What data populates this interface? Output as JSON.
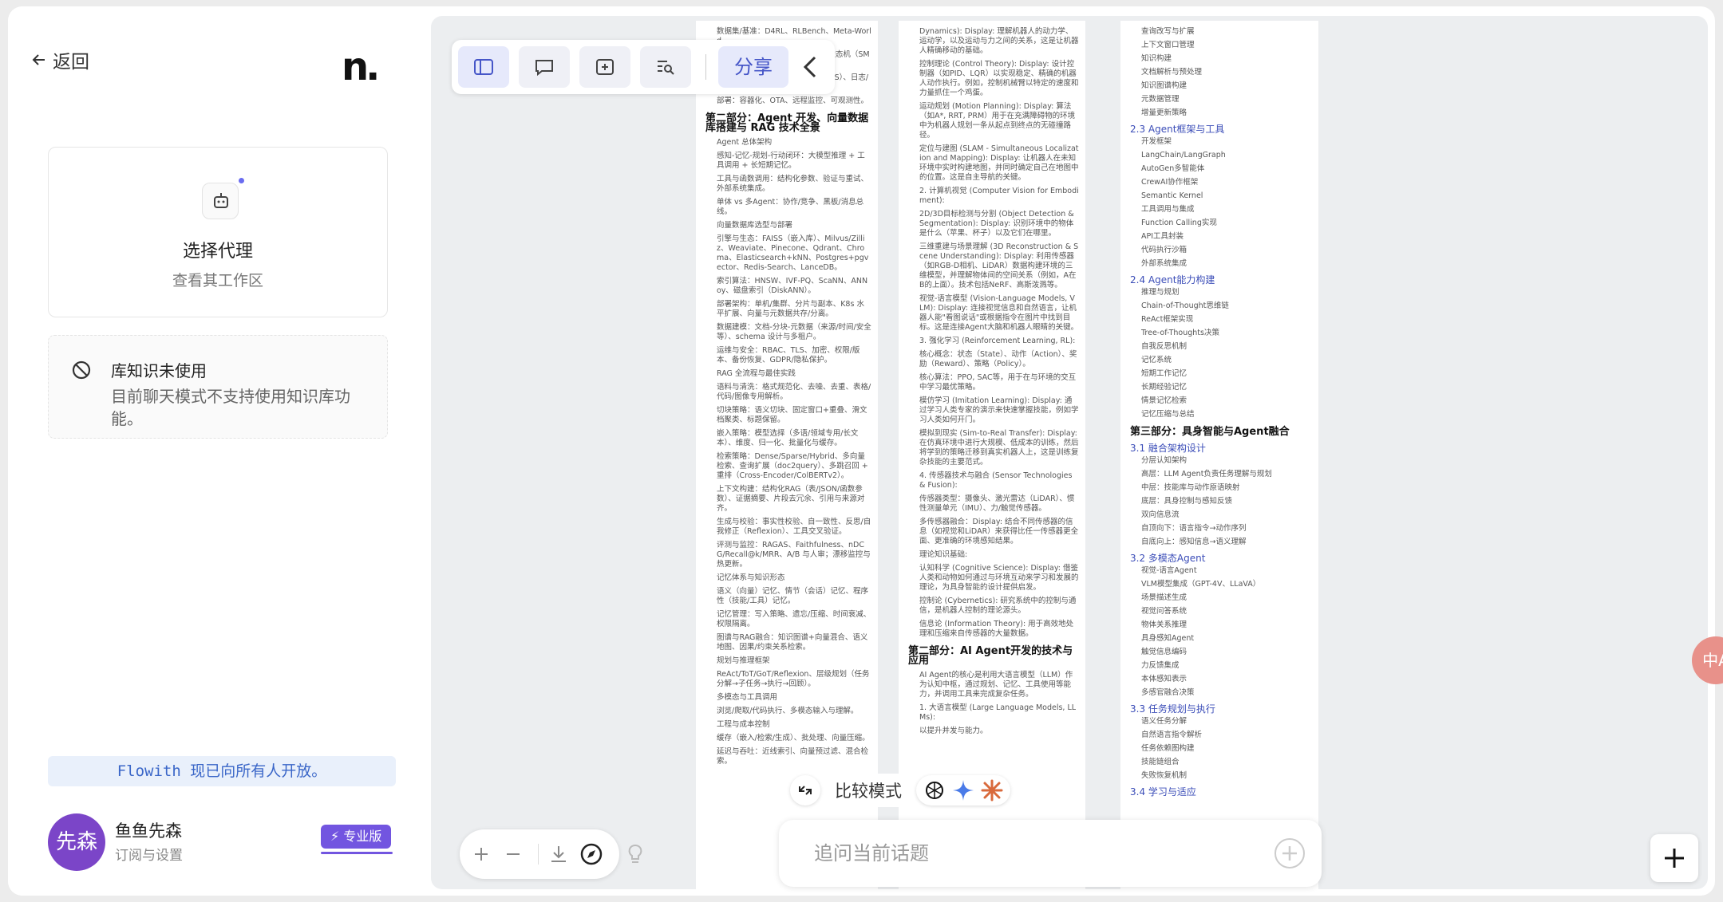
{
  "sidebar": {
    "back_label": "返回",
    "logo": "n.",
    "agent_card": {
      "title": "选择代理",
      "subtitle": "查看其工作区"
    },
    "kb_card": {
      "title": "库知识未使用",
      "subtitle": "目前聊天模式不支持使用知识库功能。"
    },
    "banner": "Flowith 现已向所有人开放。",
    "user": {
      "avatar_text": "先森",
      "name": "鱼鱼先森",
      "subtitle": "订阅与设置",
      "badge": "专业版"
    }
  },
  "toolbar": {
    "share_label": "分享"
  },
  "compare": {
    "label": "比较模式"
  },
  "chat": {
    "placeholder": "追问当前话题"
  },
  "translate_badge": "中A",
  "doc": {
    "p1": [
      "数据集/基准：D4RL、RLBench、Meta-World",
      "ROS2/RT-Middleware、行为树/状态机（SMACH/BehaviorTree.CPP）。",
      "软件架构：节点化、实时通信（DDS）、日志/回放（rosbag）。",
      "部署：容器化、OTA、远程监控、可观测性。",
      "第二部分：Agent 开发、向量数据库搭建与 RAG 技术全景",
      "Agent 总体架构",
      "感知-记忆-规划-行动闭环：大模型推理 + 工具调用 + 长短期记忆。",
      "工具与函数调用：结构化参数、验证与重试、外部系统集成。",
      "单体 vs 多Agent：协作/竞争、黑板/消息总线。",
      "向量数据库选型与部署",
      "引擎与生态：FAISS（嵌入库）、Milvus/Zilliz、Weaviate、Pinecone、Qdrant、Chroma、Elasticsearch+kNN、Postgres+pgvector、Redis-Search、LanceDB。",
      "索引算法：HNSW、IVF-PQ、ScaNN、ANNoy、磁盘索引（DiskANN）。",
      "部署架构：单机/集群、分片与副本、K8s 水平扩展、向量与元数据共存/分离。",
      "数据建模：文档-分块-元数据（来源/时间/安全等）、schema 设计与多租户。",
      "运维与安全：RBAC、TLS、加密、权限/版本、备份恢复、GDPR/隐私保护。",
      "RAG 全流程与最佳实践",
      "语料与清洗：格式规范化、去噪、去重、表格/代码/图像专用解析。",
      "切块策略：语义切块、固定窗口+重叠、滑文档聚类、标题保留。",
      "嵌入策略：模型选择（多语/领域专用/长文本）、维度、归一化、批量化与缓存。",
      "检索策略：Dense/Sparse/Hybrid、多向量检索、查询扩展（doc2query）、多跳召回 + 重排（Cross-Encoder/ColBERTv2）。",
      "上下文构建：结构化RAG（表/JSON/函数参数）、证据摘要、片段去冗余、引用与来源对齐。",
      "生成与校验：事实性校验、自一致性、反思/自我修正（Reflexion）、工具交叉验证。",
      "评测与监控：RAGAS、Faithfulness、nDCG/Recall@k/MRR、A/B 与人审；漂移监控与热更新。",
      "记忆体系与知识形态",
      "语义（向量）记忆、情节（会话）记忆、程序性（技能/工具）记忆。",
      "记忆管理：写入策略、遗忘/压缩、时间衰减、权限隔离。",
      "图谱与RAG融合：知识图谱+向量混合、语义地图、因果/约束关系检索。",
      "规划与推理框架",
      "ReAct/ToT/GoT/Reflexion、层级规划（任务分解→子任务→执行→回顾）。",
      "多模态与工具调用",
      "浏览/爬取/代码执行、多模态输入与理解。",
      "工程与成本控制",
      "缓存（嵌入/检索/生成）、批处理、向量压缩。",
      "延迟与吞吐：近线索引、向量预过滤、混合检索。"
    ],
    "p2": [
      "Dynamics): Display: 理解机器人的动力学、运动学，以及运动与力之间的关系，这是让机器人精确移动的基础。",
      "控制理论 (Control Theory): Display: 设计控制器（如PID、LQR）以实现稳定、精确的机器人动作执行。例如，控制机械臂以特定的速度和力量抓住一个鸡蛋。",
      "运动规划 (Motion Planning): Display: 算法（如A*, RRT, PRM）用于在充满障碍物的环境中为机器人规划一条从起点到终点的无碰撞路径。",
      "定位与建图 (SLAM - Simultaneous Localization and Mapping): Display: 让机器人在未知环境中实时构建地图，并同时确定自己在地图中的位置。这是自主导航的关键。",
      "2. 计算机视觉 (Computer Vision for Embodiment):",
      "2D/3D目标检测与分割 (Object Detection & Segmentation): Display: 识别环境中的物体是什么（苹果、杯子）以及它们在哪里。",
      "三维重建与场景理解 (3D Reconstruction & Scene Understanding): Display: 利用传感器（如RGB-D相机、LiDAR）数据构建环境的三维模型，并理解物体间的空间关系（例如，A在B的上面）。技术包括NeRF、高斯泼溅等。",
      "视觉-语言模型 (Vision-Language Models, VLM): Display: 连接视觉信息和自然语言，让机器人能\"看图说话\"或根据指令在图片中找到目标。这是连接Agent大脑和机器人眼睛的关键。",
      "3. 强化学习 (Reinforcement Learning, RL):",
      "核心概念：状态（State）、动作（Action）、奖励（Reward）、策略（Policy）。",
      "核心算法：PPO, SAC等，用于在与环境的交互中学习最优策略。",
      "模仿学习 (Imitation Learning): Display: 通过学习人类专家的演示来快速掌握技能，例如学习人类如何开门。",
      "模拟到现实 (Sim-to-Real Transfer): Display: 在仿真环境中进行大规模、低成本的训练，然后将学到的策略迁移到真实机器人上，这是训练复杂技能的主要范式。",
      "4. 传感器技术与融合 (Sensor Technologies & Fusion):",
      "传感器类型：摄像头、激光雷达（LiDAR）、惯性测量单元（IMU）、力/触觉传感器。",
      "多传感器融合：Display: 结合不同传感器的信息（如视觉和LiDAR）来获得比任一传感器更全面、更准确的环境感知结果。",
      "理论知识基础:",
      "认知科学 (Cognitive Science): Display: 借鉴人类和动物如何通过与环境互动来学习和发展的理论，为具身智能的设计提供启发。",
      "控制论 (Cybernetics): 研究系统中的控制与通信，是机器人控制的理论源头。",
      "信息论 (Information Theory): 用于高效地处理和压缩来自传感器的大量数据。",
      "第二部分：AI Agent开发的技术与应用",
      "AI Agent的核心是利用大语言模型（LLM）作为认知中枢，通过规划、记忆、工具使用等能力，并调用工具来完成复杂任务。",
      "1. 大语言模型 (Large Language Models, LLMs):",
      "以提升并发与能力。"
    ],
    "p3": [
      "查询改写与扩展",
      "上下文窗口管理",
      "知识构建",
      "文档解析与预处理",
      "知识图谱构建",
      "元数据管理",
      "增量更新策略",
      "2.3 Agent框架与工具",
      "开发框架",
      "LangChain/LangGraph",
      "AutoGen多智能体",
      "CrewAI协作框架",
      "Semantic Kernel",
      "工具调用与集成",
      "Function Calling实现",
      "API工具封装",
      "代码执行沙箱",
      "外部系统集成",
      "2.4 Agent能力构建",
      "推理与规划",
      "Chain-of-Thought思维链",
      "ReAct框架实现",
      "Tree-of-Thoughts决策",
      "自我反思机制",
      "记忆系统",
      "短期工作记忆",
      "长期经验记忆",
      "情景记忆检索",
      "记忆压缩与总结",
      "第三部分：具身智能与Agent融合",
      "3.1 融合架构设计",
      "分层认知架构",
      "高层：LLM Agent负责任务理解与规划",
      "中层：技能库与动作原语映射",
      "底层：具身控制与感知反馈",
      "双向信息流",
      "自顶向下：语言指令→动作序列",
      "自底向上：感知信息→语义理解",
      "3.2 多模态Agent",
      "视觉-语言Agent",
      "VLM模型集成（GPT-4V、LLaVA）",
      "场景描述生成",
      "视觉问答系统",
      "物体关系推理",
      "具身感知Agent",
      "触觉信息编码",
      "力反馈集成",
      "本体感知表示",
      "多感官融合决策",
      "3.3 任务规划与执行",
      "语义任务分解",
      "自然语言指令解析",
      "任务依赖图构建",
      "技能链组合",
      "失败恢复机制",
      "3.4 学习与适应"
    ]
  }
}
